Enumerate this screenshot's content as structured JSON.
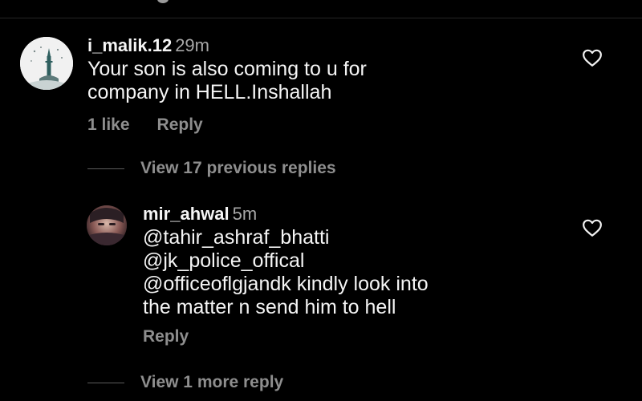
{
  "comments": [
    {
      "username": "i_malik.12",
      "time": "29m",
      "text_lines": [
        "Your son is also coming to u for",
        "company in HELL.Inshallah"
      ],
      "likes": "1 like",
      "reply": "Reply"
    },
    {
      "username": "mir_ahwal",
      "time": "5m",
      "text_lines": [
        "@tahir_ashraf_bhatti",
        "@jk_police_offical",
        "@officeoflgjandk kindly look into",
        "the matter n send him to hell"
      ],
      "reply": "Reply"
    }
  ],
  "replies_toggle_1": "View 17 previous replies",
  "replies_toggle_2": "View 1 more reply",
  "icons": {
    "like": "heart-outline-icon",
    "avatar_1": "mosque-minaret-avatar",
    "avatar_2": "user-avatar"
  },
  "colors": {
    "background": "#000000",
    "primary_text": "#f5f5f5",
    "secondary_text": "#8e8e8e"
  }
}
